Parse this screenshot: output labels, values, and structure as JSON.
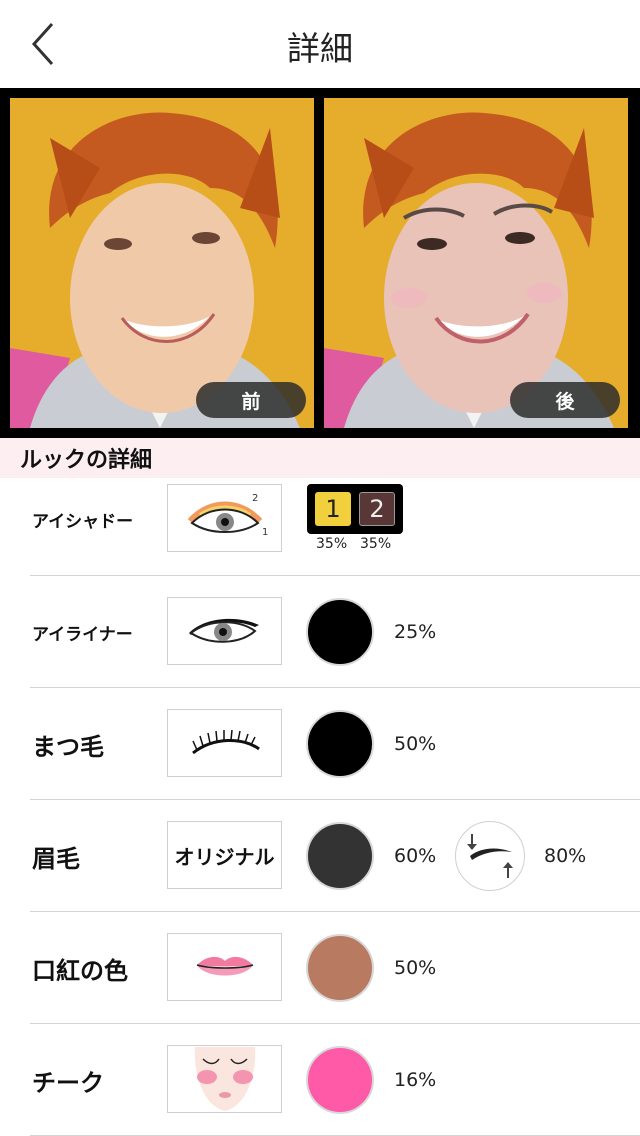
{
  "header": {
    "title": "詳細"
  },
  "photos": {
    "before_label": "前",
    "after_label": "後"
  },
  "section": {
    "title": "ルックの詳細"
  },
  "rows": [
    {
      "label": "アイシャドー",
      "thumb_icon": "eyeshadow-icon",
      "palette": [
        {
          "number": "1",
          "color": "#f2cf3d",
          "percent": "35%"
        },
        {
          "number": "2",
          "color": "#5a3737",
          "percent": "35%"
        }
      ]
    },
    {
      "label": "アイライナー",
      "thumb_icon": "eyeliner-icon",
      "color": "#000000",
      "percent": "25%"
    },
    {
      "label": "まつ毛",
      "thumb_icon": "eyelash-icon",
      "color": "#000000",
      "percent": "50%"
    },
    {
      "label": "眉毛",
      "thumb_text": "オリジナル",
      "color": "#333333",
      "percent": "60%",
      "adjust_icon": "eyebrow-adjust-icon",
      "adjust_percent": "80%"
    },
    {
      "label": "口紅の色",
      "thumb_icon": "lips-icon",
      "color": "#b97a62",
      "percent": "50%"
    },
    {
      "label": "チーク",
      "thumb_icon": "cheek-face-icon",
      "color": "#ff5aa8",
      "percent": "16%"
    }
  ]
}
